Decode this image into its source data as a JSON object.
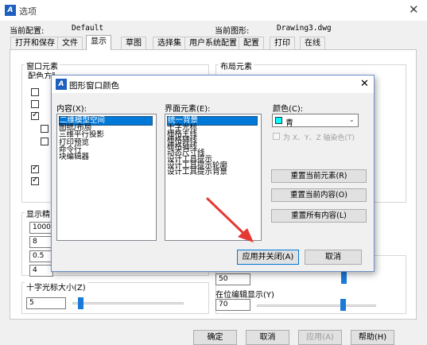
{
  "window": {
    "title": "选项",
    "close": "✕"
  },
  "profile": {
    "label": "当前配置:",
    "value": "Default"
  },
  "drawing": {
    "label": "当前图形:",
    "value": "Drawing3.dwg"
  },
  "tabs": [
    "打开和保存",
    "文件",
    "显示",
    "草图",
    "选择集",
    "用户系统配置",
    "配置",
    "打印",
    "在线"
  ],
  "panel": {
    "window_elements": "窗口元素",
    "color_scheme_partial": "配色方案(M):",
    "layout_elements": "布局元素",
    "display_res_partial": "显示精",
    "res_values": [
      "1000",
      "8",
      "0.5",
      "4"
    ],
    "crosshair_label": "十字光标大小(Z)",
    "crosshair_value": "5",
    "right_value1": "50",
    "inplace_label": "在位编辑显示(Y)",
    "inplace_value": "70",
    "crosshair_level": 0.05,
    "inplace_level": 0.7
  },
  "bottom_buttons": {
    "ok": "确定",
    "cancel": "取消",
    "apply": "应用(A)",
    "help": "帮助(H)"
  },
  "dialog": {
    "title": "图形窗口颜色",
    "close": "✕",
    "content_label": "内容(X):",
    "content_items": [
      "二维模型空间",
      "图纸/布局",
      "三维平行投影",
      "打印预览",
      "命令行",
      "块编辑器"
    ],
    "element_label": "界面元素(E):",
    "element_items": [
      "统一背景",
      "十字光标",
      "栅格主线",
      "栅格辅线",
      "栅格轴线",
      "动态尺寸线",
      "设计工具提示",
      "设计工具提示轮廓",
      "设计工具提示背景"
    ],
    "color_label": "颜色(C):",
    "color_value": "青",
    "color_hex": "#00ffff",
    "tint_label": "为 X、Y、Z 轴染色(T)",
    "btn_reset_current": "重置当前元素(R)",
    "btn_reset_context": "重置当前内容(O)",
    "btn_reset_all": "重置所有内容(L)",
    "btn_apply_close": "应用并关闭(A)",
    "btn_cancel": "取消"
  }
}
